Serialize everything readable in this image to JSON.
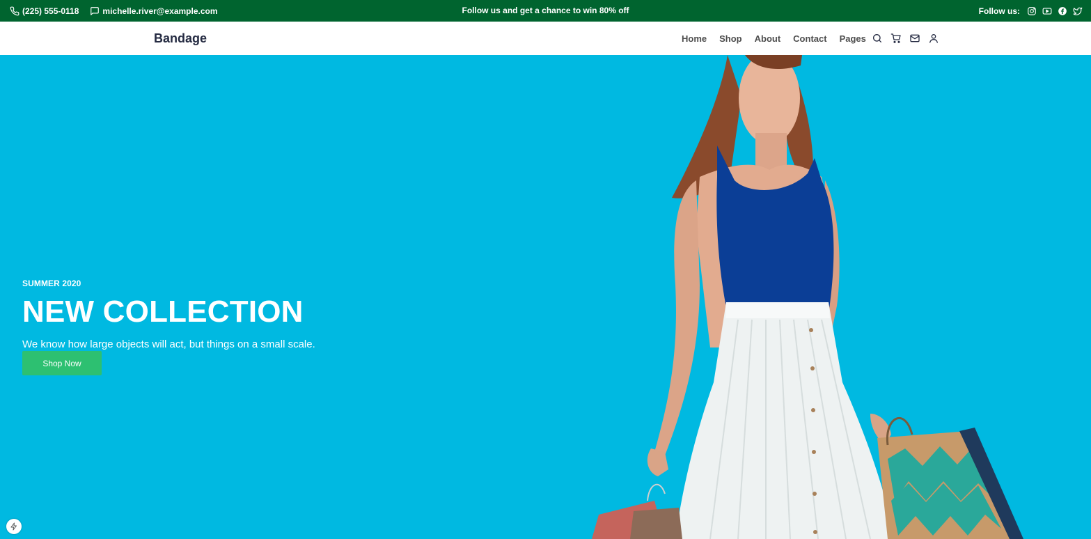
{
  "topbar": {
    "phone": "(225) 555-0118",
    "email": "michelle.river@example.com",
    "promo": "Follow us and get a chance to win 80% off",
    "follow_label": "Follow us:",
    "social_icons": [
      "instagram-icon",
      "youtube-icon",
      "facebook-icon",
      "twitter-icon"
    ]
  },
  "navbar": {
    "brand": "Bandage",
    "menu": [
      "Home",
      "Shop",
      "About",
      "Contact",
      "Pages"
    ],
    "icons": [
      "search-icon",
      "cart-icon",
      "mail-icon",
      "user-icon"
    ]
  },
  "hero": {
    "season": "SUMMER 2020",
    "headline": "NEW COLLECTION",
    "subtitle": "We know how large objects will act, but things on a small scale.",
    "cta": "Shop Now"
  },
  "colors": {
    "topbar_bg": "#00642f",
    "hero_bg": "#00b9e1",
    "cta_bg": "#2dc071",
    "brand_text": "#252b42"
  }
}
